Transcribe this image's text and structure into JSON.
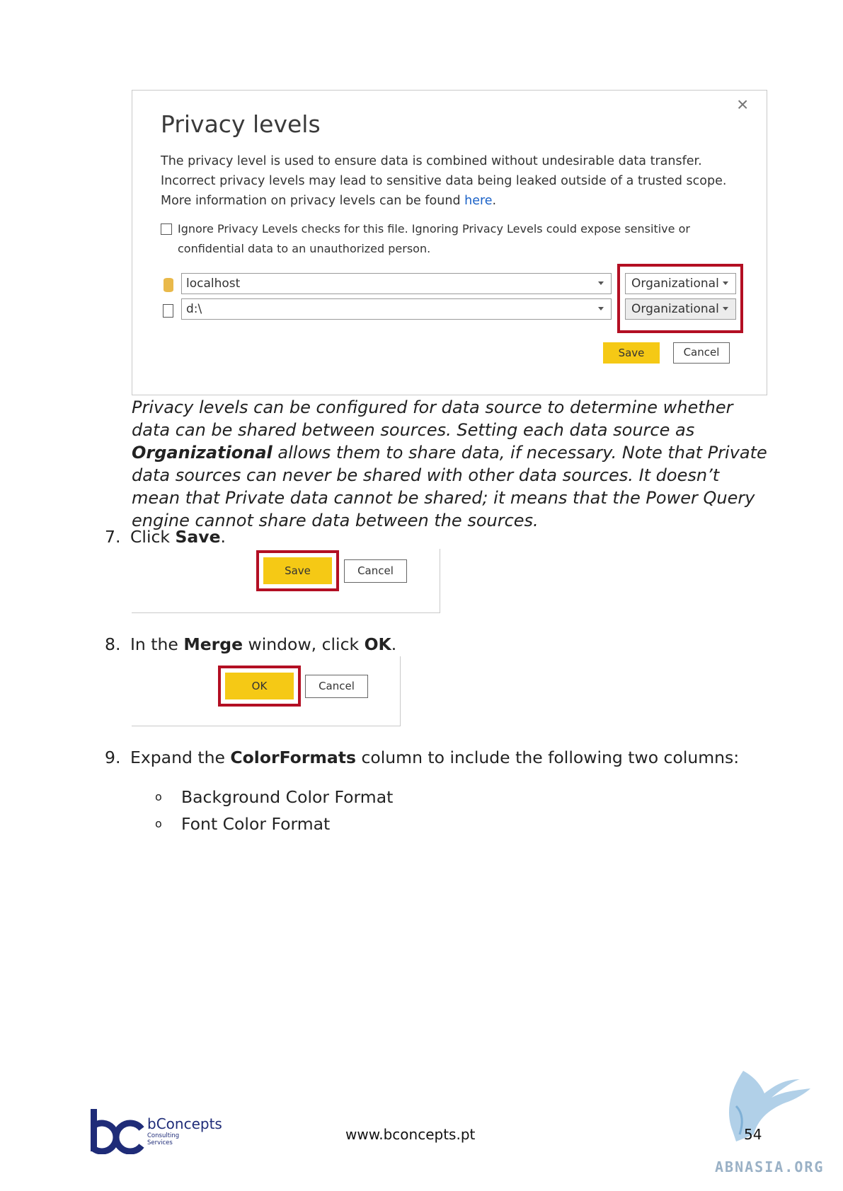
{
  "dialog": {
    "title": "Privacy levels",
    "description": "The privacy level is used to ensure data is combined without undesirable data transfer. Incorrect privacy levels may lead to sensitive data being leaked outside of a trusted scope. More information on privacy levels can be found ",
    "link_text": "here",
    "link_suffix": ".",
    "close_icon": "×",
    "ignore_checkbox_label": "Ignore Privacy Levels checks for this file. Ignoring Privacy Levels could expose sensitive or confidential data to an unauthorized person.",
    "ignore_checked": false,
    "sources": [
      {
        "icon": "database-icon",
        "name": "localhost",
        "level": "Organizational"
      },
      {
        "icon": "file-icon",
        "name": "d:\\",
        "level": "Organizational"
      }
    ],
    "save_label": "Save",
    "cancel_label": "Cancel"
  },
  "caption": {
    "part1": "Privacy levels can be configured for data source to determine whether data can be shared between sources. Setting each data source as ",
    "bold": "Organizational",
    "part2": " allows them to share data, if necessary. Note that Private data sources can never be shared with other data sources. It doesn’t mean that Private data cannot be shared; it means that the Power Query engine cannot share data between the sources."
  },
  "steps": [
    {
      "num": "7.",
      "pre": "Click ",
      "bold": "Save",
      "post": "."
    },
    {
      "num": "8.",
      "pre": "In the ",
      "bold": "Merge",
      "mid": " window, click ",
      "bold2": "OK",
      "post": "."
    },
    {
      "num": "9.",
      "pre": "Expand the ",
      "bold": "ColorFormats",
      "post": " column to include the following two columns:"
    }
  ],
  "step7_buttons": {
    "save_label": "Save",
    "cancel_label": "Cancel"
  },
  "step8_buttons": {
    "ok_label": "OK",
    "cancel_label": "Cancel"
  },
  "bullets": [
    {
      "mark": "o",
      "text": "Background Color Format"
    },
    {
      "mark": "o",
      "text": "Font Color Format"
    }
  ],
  "footer": {
    "logo_name": "bConcepts",
    "logo_sub1": "Consulting",
    "logo_sub2": "Services",
    "url": "www.bconcepts.pt",
    "page_number": "54",
    "watermark": "ABNASIA.ORG"
  },
  "colors": {
    "highlight_red": "#b30f23",
    "button_yellow": "#f5c915",
    "link_blue": "#1a61c7",
    "brand_navy": "#1f2c78"
  }
}
